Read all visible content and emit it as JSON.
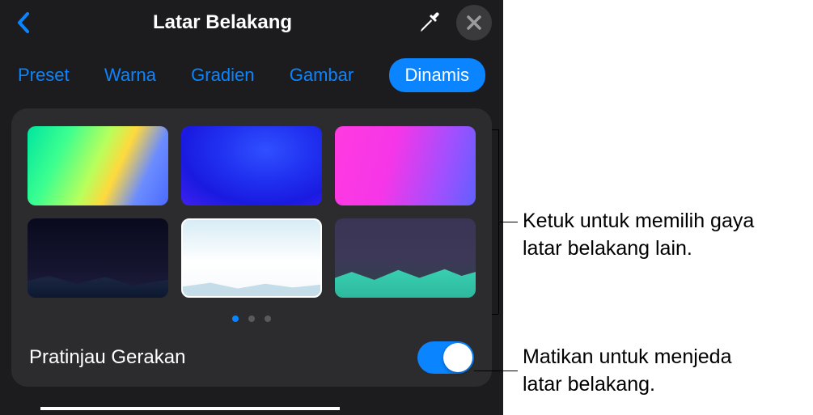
{
  "header": {
    "title": "Latar Belakang"
  },
  "tabs": {
    "items": [
      {
        "label": "Preset"
      },
      {
        "label": "Warna"
      },
      {
        "label": "Gradien"
      },
      {
        "label": "Gambar"
      },
      {
        "label": "Dinamis"
      }
    ],
    "active_index": 4
  },
  "pagination": {
    "pages": 3,
    "active": 0
  },
  "motion_preview": {
    "label": "Pratinjau Gerakan",
    "enabled": true
  },
  "callouts": {
    "thumb_hint_line1": "Ketuk untuk memilih gaya",
    "thumb_hint_line2": "latar belakang lain.",
    "toggle_hint_line1": "Matikan untuk menjeda",
    "toggle_hint_line2": "latar belakang."
  }
}
